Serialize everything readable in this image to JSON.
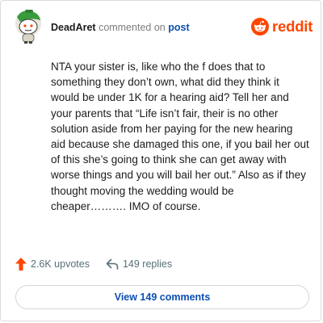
{
  "header": {
    "username": "DeadAret",
    "action_text": "commented on",
    "target_text": "post",
    "brand_name": "reddit"
  },
  "comment": {
    "text": "NTA your sister is, like who the f does that to something they don’t own, what did they think it would be under 1K for a hearing aid? Tell her and your parents that “Life isn’t fair, their is no other solution aside from her paying for the new hearing aid because she damaged this one, if you bail her out of this she’s going to think she can get away with worse things and you will bail her out.” Also as if they thought moving the wedding would be cheaper………. IMO of course."
  },
  "actions": {
    "upvotes_label": "2.6K upvotes",
    "replies_label": "149 replies"
  },
  "view_button": {
    "label": "View 149 comments"
  },
  "colors": {
    "brand": "#ff4500",
    "link": "#0b4fb3",
    "text": "#1c1c1c",
    "muted": "#576f76"
  },
  "icons": {
    "avatar": "snoo-avatar",
    "brand": "reddit-logo-icon",
    "upvote": "upvote-arrow-icon",
    "reply": "reply-arrow-icon"
  }
}
